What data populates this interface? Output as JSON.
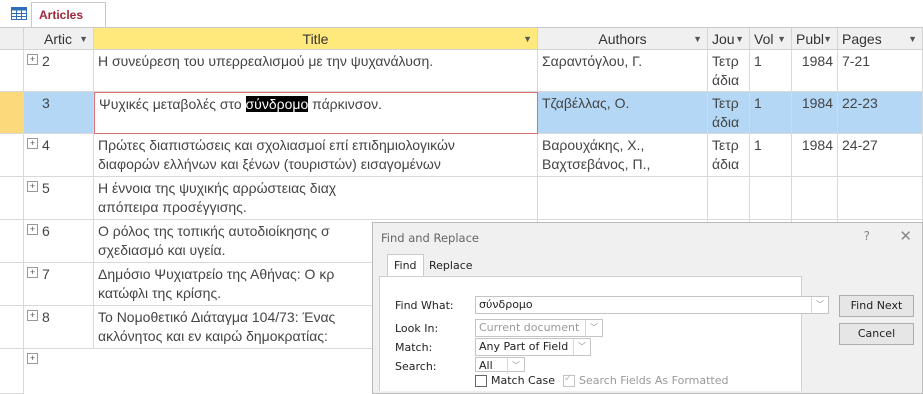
{
  "tab": {
    "label": "Articles"
  },
  "columns": {
    "id": "Artic",
    "title": "Title",
    "authors": "Authors",
    "journal": "Jou",
    "volume": "Vol",
    "published": "Publ",
    "pages": "Pages"
  },
  "rows": [
    {
      "id": "2",
      "title1": "Η συνεύρεση του υπερρεαλισμού με την ψυχανάλυση.",
      "title2": "",
      "authors1": "Σαραντόγλου, Γ.",
      "authors2": "",
      "journal1": "Τετρ",
      "journal2": "άδια",
      "volume": "1",
      "year": "1984",
      "pages": "7-21"
    },
    {
      "id": "3",
      "title_pre": "Ψυχικές μεταβολές στο ",
      "title_hl": "σύνδρομο",
      "title_post": " πάρκινσον.",
      "authors1": "Τζαβέλλας, Ο.",
      "authors2": "",
      "journal1": "Τετρ",
      "journal2": "άδια",
      "volume": "1",
      "year": "1984",
      "pages": "22-23"
    },
    {
      "id": "4",
      "title1": "Πρώτες διαπιστώσεις και σχολιασμοί επί επιδημιολογικών",
      "title2": "διαφορών ελλήνων και ξένων (τουριστών) εισαγομένων",
      "authors1": "Βαρουχάκης, Χ.,",
      "authors2": "Βαχτσεβάνος, Π.,",
      "journal1": "Τετρ",
      "journal2": "άδια",
      "volume": "1",
      "year": "1984",
      "pages": "24-27"
    },
    {
      "id": "5",
      "title1": "Η έννοια της ψυχικής αρρώστειας διαχ",
      "title2": "απόπειρα προσέγγισης.",
      "authors1": "",
      "authors2": "",
      "journal1": "",
      "journal2": "",
      "volume": "",
      "year": "",
      "pages": ""
    },
    {
      "id": "6",
      "title1": "Ο ρόλος της τοπικής αυτοδιοίκησης σ",
      "title2": "σχεδιασμό και υγεία.",
      "authors1": "",
      "authors2": "",
      "journal1": "",
      "journal2": "",
      "volume": "",
      "year": "",
      "pages": ""
    },
    {
      "id": "7",
      "title1": "Δημόσιο Ψυχιατρείο της Αθήνας: Ο κρ",
      "title2": "κατώφλι της κρίσης.",
      "authors1": "",
      "authors2": "",
      "journal1": "",
      "journal2": "",
      "volume": "",
      "year": "",
      "pages": ""
    },
    {
      "id": "8",
      "title1": "Το Νομοθετικό Διάταγμα 104/73: Ένας",
      "title2": "ακλόνητος και εν καιρώ δημοκρατίας:",
      "authors1": "",
      "authors2": "",
      "journal1": "",
      "journal2": "",
      "volume": "",
      "year": "",
      "pages": ""
    }
  ],
  "dialog": {
    "title": "Find and Replace",
    "help": "?",
    "close": "✕",
    "tabs": {
      "find": "Find",
      "replace": "Replace"
    },
    "find_what_label": "Find What:",
    "find_what_value": "σύνδρομο",
    "look_in_label": "Look In:",
    "look_in_value": "Current document",
    "match_label": "Match:",
    "match_value": "Any Part of Field",
    "search_label": "Search:",
    "search_value": "All",
    "match_case_label": "Match Case",
    "search_formatted_label": "Search Fields As Formatted",
    "find_next": "Find Next",
    "cancel": "Cancel"
  },
  "colors": {
    "tab_text": "#a3263a",
    "selected_header": "#ffe87c",
    "current_row": "#b3d7f5",
    "record_selector": "#fcd97a"
  }
}
